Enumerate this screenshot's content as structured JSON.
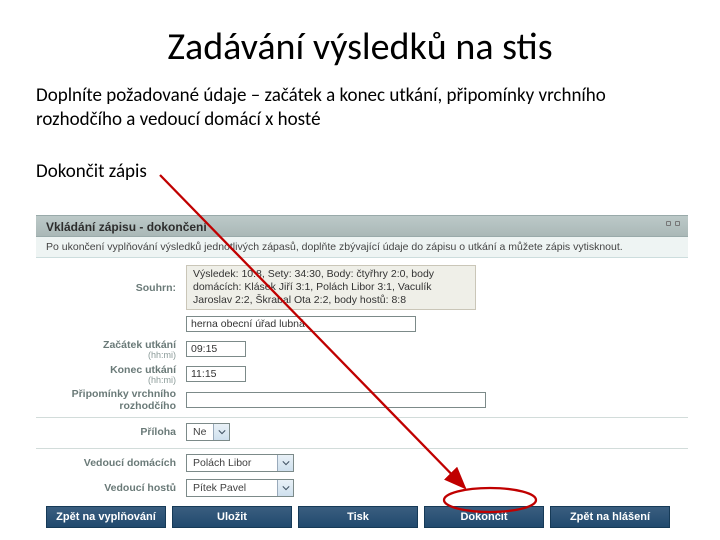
{
  "slide": {
    "title": "Zadávání výsledků na stis",
    "para1": "Doplníte požadované údaje – začátek a konec utkání, připomínky vrchního rozhodčího a vedoucí domácí x hosté",
    "para2": "Dokončit zápis"
  },
  "app": {
    "section_header": "Vkládání zápisu - dokončení",
    "info_text": "Po ukončení vyplňování výsledků jednotlivých zápasů, doplňte zbývající údaje do zápisu o utkání a můžete zápis vytisknout.",
    "labels": {
      "summary": "Souhrn:",
      "start": "Začátek utkání",
      "start_hint": "(hh:mi)",
      "end": "Konec utkání",
      "end_hint": "(hh:mi)",
      "ref_notes": "Připomínky vrchního rozhodčího",
      "attachment": "Příloha",
      "leader_home": "Vedoucí domácích",
      "leader_guests": "Vedoucí hostů"
    },
    "values": {
      "summary": "Výsledek: 10:8, Sety: 34:30, Body: čtyřhry 2:0, body domácích: Klásek Jiří 3:1, Polách Libor 3:1, Vaculík Jaroslav 2:2, Škrabal Ota 2:2, body hostů: 8:8",
      "venue": "herna obecní úřad lubná",
      "start": "09:15",
      "end": "11:15",
      "ref_notes": "",
      "attachment": "Ne",
      "leader_home": "Polách Libor",
      "leader_guests": "Pítek Pavel"
    },
    "buttons": {
      "back_fill": "Zpět na vyplňování",
      "save": "Uložit",
      "print": "Tisk",
      "finish": "Dokončit",
      "back_report": "Zpět na hlášení"
    }
  }
}
